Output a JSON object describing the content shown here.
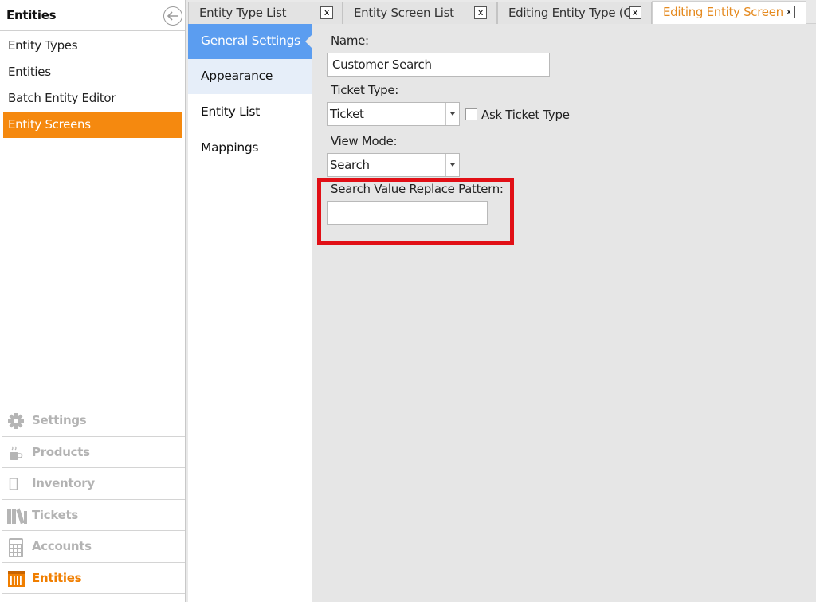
{
  "left_panel": {
    "title": "Entities",
    "menu_items": [
      {
        "label": "Entity Types",
        "active": false
      },
      {
        "label": "Entities",
        "active": false
      },
      {
        "label": "Batch Entity Editor",
        "active": false
      },
      {
        "label": "Entity Screens",
        "active": true
      }
    ],
    "sections": [
      {
        "label": "Settings",
        "icon": "gear-icon"
      },
      {
        "label": "Products",
        "icon": "coffee-cup-icon"
      },
      {
        "label": "Inventory",
        "icon": "inventory-icon"
      },
      {
        "label": "Tickets",
        "icon": "books-icon"
      },
      {
        "label": "Accounts",
        "icon": "calculator-icon"
      },
      {
        "label": "Entities",
        "icon": "entities-icon",
        "active": true
      }
    ]
  },
  "tabs": [
    {
      "label": "Entity Type List",
      "close": "x"
    },
    {
      "label": "Entity Screen List",
      "close": "x"
    },
    {
      "label": "Editing Entity Type (Cu",
      "close": "x"
    },
    {
      "label": "Editing Entity Screen (",
      "close": "x",
      "active": true
    }
  ],
  "settings_nav": [
    {
      "label": "General Settings",
      "active": true
    },
    {
      "label": "Appearance"
    },
    {
      "label": "Entity List"
    },
    {
      "label": "Mappings"
    }
  ],
  "form": {
    "name_label": "Name:",
    "name_value": "Customer Search",
    "ticket_type_label": "Ticket Type:",
    "ticket_type_value": "Ticket",
    "ask_ticket_type_label": "Ask Ticket Type",
    "ask_ticket_type_checked": false,
    "view_mode_label": "View Mode:",
    "view_mode_value": "Search",
    "search_pattern_label": "Search Value Replace Pattern:",
    "search_pattern_value": ""
  },
  "colors": {
    "accent_orange": "#f5890f",
    "active_blue": "#5b9df0",
    "highlight_red": "#e10f16"
  }
}
